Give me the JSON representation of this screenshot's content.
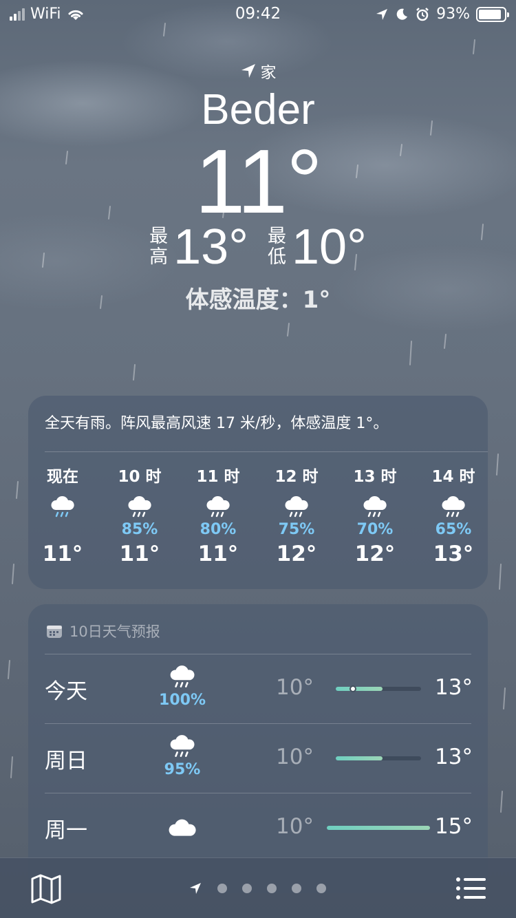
{
  "status_bar": {
    "carrier": "WiFi",
    "time": "09:42",
    "battery": "93%"
  },
  "header": {
    "location_label": "家",
    "city": "Beder",
    "temperature": "11°",
    "high_label_1": "最",
    "high_label_2": "高",
    "high": "13°",
    "low_label_1": "最",
    "low_label_2": "低",
    "low": "10°",
    "feels_like": "体感温度：1°"
  },
  "hourly": {
    "summary": "全天有雨。阵风最高风速 17 米/秒，体感温度 1°。",
    "items": [
      {
        "label": "现在",
        "precip": "",
        "temp": "11°",
        "icon": "rain-cloud-icon"
      },
      {
        "label": "10 时",
        "precip": "85%",
        "temp": "11°",
        "icon": "rain-cloud-icon"
      },
      {
        "label": "11 时",
        "precip": "80%",
        "temp": "11°",
        "icon": "rain-cloud-icon"
      },
      {
        "label": "12 时",
        "precip": "75%",
        "temp": "12°",
        "icon": "rain-cloud-icon"
      },
      {
        "label": "13 时",
        "precip": "70%",
        "temp": "12°",
        "icon": "rain-cloud-icon"
      },
      {
        "label": "14 时",
        "precip": "65%",
        "temp": "13°",
        "icon": "rain-cloud-icon"
      }
    ]
  },
  "daily": {
    "title": "10日天气预报",
    "days": [
      {
        "name": "今天",
        "precip": "100%",
        "low": "10°",
        "high": "13°",
        "icon": "rain-cloud-icon",
        "range_start": 0.0,
        "range_end": 0.55,
        "current": 0.2
      },
      {
        "name": "周日",
        "precip": "95%",
        "low": "10°",
        "high": "13°",
        "icon": "rain-cloud-icon",
        "range_start": 0.0,
        "range_end": 0.55
      },
      {
        "name": "周一",
        "precip": "",
        "low": "10°",
        "high": "15°",
        "icon": "cloud-icon",
        "range_start": 0.0,
        "range_end": 1.0
      }
    ]
  },
  "colors": {
    "precip_text": "#7ec9f5",
    "range_bar": "#7fd3c0"
  }
}
